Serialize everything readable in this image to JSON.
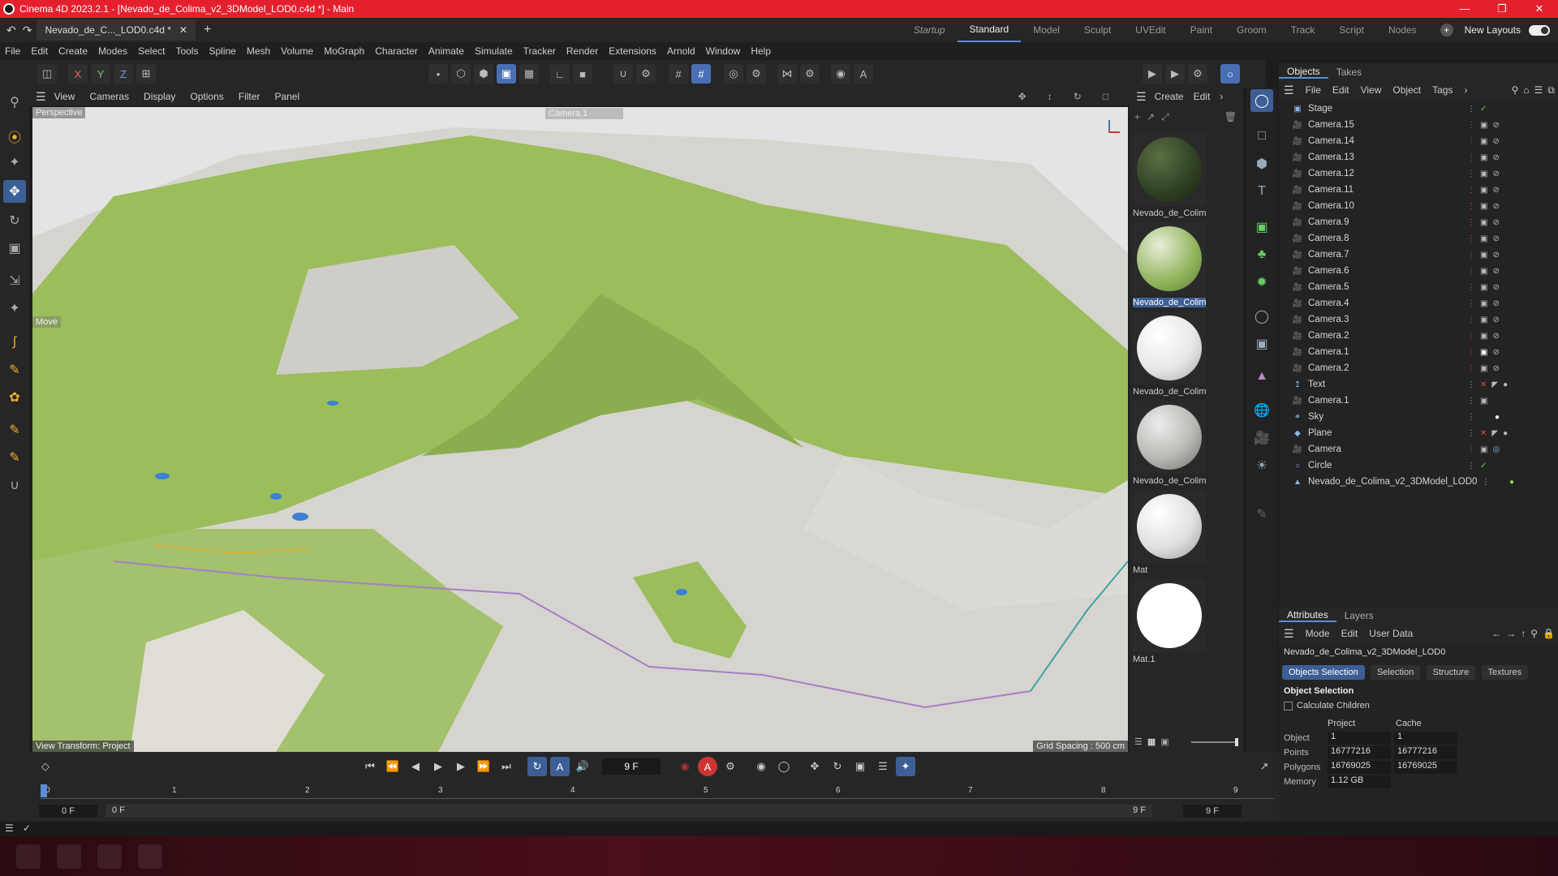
{
  "titlebar": {
    "title": "Cinema 4D 2023.2.1 - [Nevado_de_Colima_v2_3DModel_LOD0.c4d *] - Main"
  },
  "tabs": {
    "doc_tab": "Nevado_de_C..._LOD0.c4d *",
    "layouts": [
      "Startup",
      "Standard",
      "Model",
      "Sculpt",
      "UVEdit",
      "Paint",
      "Groom",
      "Track",
      "Script",
      "Nodes"
    ],
    "active_layout": "Standard",
    "new_layouts": "New Layouts"
  },
  "menubar": [
    "File",
    "Edit",
    "Create",
    "Modes",
    "Select",
    "Tools",
    "Spline",
    "Mesh",
    "Volume",
    "MoGraph",
    "Character",
    "Animate",
    "Simulate",
    "Tracker",
    "Render",
    "Extensions",
    "Arnold",
    "Window",
    "Help"
  ],
  "toolbar": {
    "x": "X",
    "y": "Y",
    "z": "Z"
  },
  "viewport": {
    "menu": [
      "View",
      "Cameras",
      "Display",
      "Options",
      "Filter",
      "Panel"
    ],
    "perspective": "Perspective",
    "camera": "Camera.1",
    "move_label": "Move",
    "view_transform": "View Transform: Project",
    "grid_spacing": "Grid Spacing : 500 cm"
  },
  "materials": {
    "menu": [
      "Create",
      "Edit"
    ],
    "items": [
      {
        "name": "Nevado_de_Colim",
        "color": "#2f3f22"
      },
      {
        "name": "Nevado_de_Colim",
        "color": "#8fb35a"
      },
      {
        "name": "Nevado_de_Colim",
        "color": "#e8e8e8"
      },
      {
        "name": "Nevado_de_Colim",
        "color": "#b9b9b4"
      },
      {
        "name": "Mat",
        "color": "#e0e0e0"
      },
      {
        "name": "Mat.1",
        "color": "#ffffff"
      }
    ]
  },
  "objects": {
    "tabs": [
      "Objects",
      "Takes"
    ],
    "menu": [
      "File",
      "Edit",
      "View",
      "Object",
      "Tags"
    ],
    "rows": [
      "Stage",
      "Camera.15",
      "Camera.14",
      "Camera.13",
      "Camera.12",
      "Camera.11",
      "Camera.10",
      "Camera.9",
      "Camera.8",
      "Camera.7",
      "Camera.6",
      "Camera.5",
      "Camera.4",
      "Camera.3",
      "Camera.2",
      "Camera.1",
      "Camera.2",
      "Text",
      "Camera.1",
      "Sky",
      "Plane",
      "Camera",
      "Circle",
      "Nevado_de_Colima_v2_3DModel_LOD0"
    ]
  },
  "attributes": {
    "tabs": [
      "Attributes",
      "Layers"
    ],
    "menu": [
      "Mode",
      "Edit",
      "User Data"
    ],
    "object_name": "Nevado_de_Colima_v2_3DModel_LOD0",
    "buttons": [
      "Objects Selection",
      "Selection",
      "Structure",
      "Textures"
    ],
    "section": "Object Selection",
    "calc_children": "Calculate Children",
    "col_project": "Project",
    "col_cache": "Cache",
    "stats": [
      {
        "label": "Object",
        "project": "1",
        "cache": "1"
      },
      {
        "label": "Points",
        "project": "16777216",
        "cache": "16777216"
      },
      {
        "label": "Polygons",
        "project": "16769025",
        "cache": "16769025"
      },
      {
        "label": "Memory",
        "project": "1.12 GB",
        "cache": ""
      }
    ]
  },
  "timeline": {
    "current_frame": "9 F",
    "ticks": [
      "0",
      "1",
      "2",
      "3",
      "4",
      "5",
      "6",
      "7",
      "8",
      "9"
    ],
    "start": "0 F",
    "range_start": "0 F",
    "range_end": "9 F",
    "end": "9 F"
  }
}
